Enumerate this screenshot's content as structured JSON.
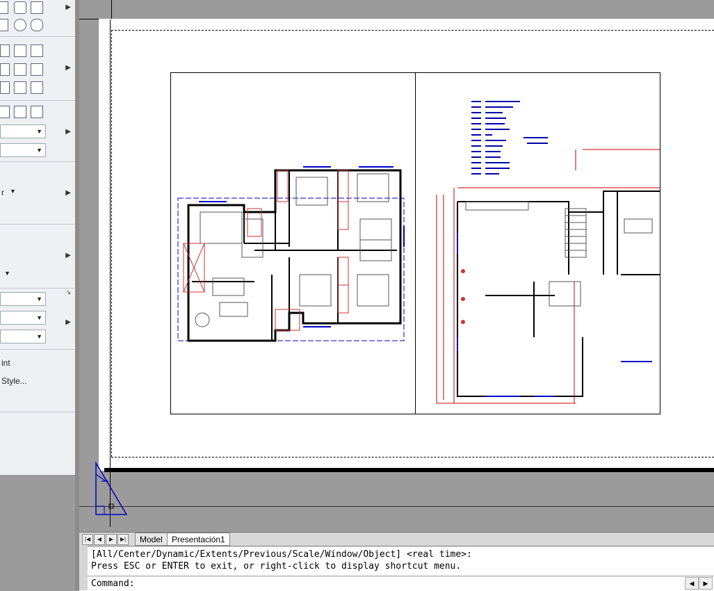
{
  "ribbon": {
    "partial_texts": [
      "r",
      "int",
      "Style..."
    ]
  },
  "tabs": [
    {
      "label": "Model"
    },
    {
      "label": "Presentación1"
    }
  ],
  "command": {
    "line1": "[All/Center/Dynamic/Extents/Previous/Scale/Window/Object] <real time>:",
    "line2": "Press ESC or ENTER to exit, or right-click to display shortcut menu.",
    "prompt": "Command:"
  },
  "colors": {
    "drawing_bg": "#9b9b9b",
    "paper": "#ffffff",
    "ribbon_bg": "#eef0f4",
    "wall": "#000000",
    "dimension": "#cc0000",
    "window": "#0000cc"
  }
}
